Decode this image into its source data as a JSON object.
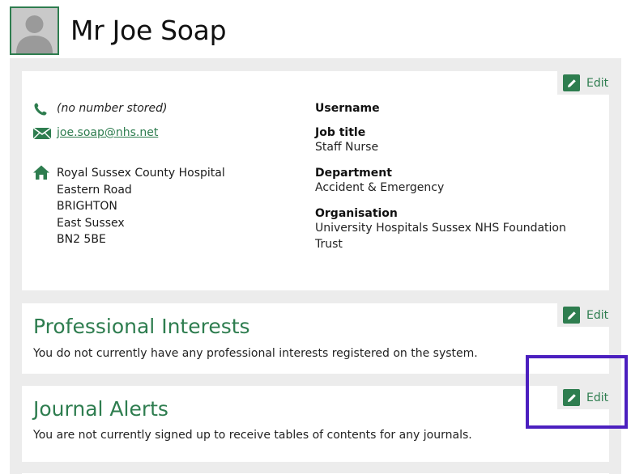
{
  "profile": {
    "name": "Mr Joe Soap",
    "avatar_icon": "user-silhouette-icon"
  },
  "contact": {
    "phone": "(no number stored)",
    "email": "joe.soap@nhs.net",
    "address": [
      "Royal Sussex County Hospital",
      "Eastern Road",
      "BRIGHTON",
      "East Sussex",
      "BN2 5BE"
    ],
    "edit_label": "Edit"
  },
  "details": {
    "username_label": "Username",
    "username_value": "",
    "job_title_label": "Job title",
    "job_title_value": "Staff Nurse",
    "department_label": "Department",
    "department_value": "Accident & Emergency",
    "organisation_label": "Organisation",
    "organisation_value_line1": "University Hospitals Sussex NHS Foundation",
    "organisation_value_line2": "Trust"
  },
  "interests": {
    "title": "Professional Interests",
    "text": "You do not currently have any professional interests registered on the system.",
    "edit_label": "Edit"
  },
  "alerts": {
    "title": "Journal Alerts",
    "text": "You are not currently signed up to receive tables of contents for any journals.",
    "edit_label": "Edit"
  },
  "colors": {
    "accent_green": "#2e7d4f",
    "panel_grey": "#ececec",
    "highlight": "#4b1fbf"
  }
}
